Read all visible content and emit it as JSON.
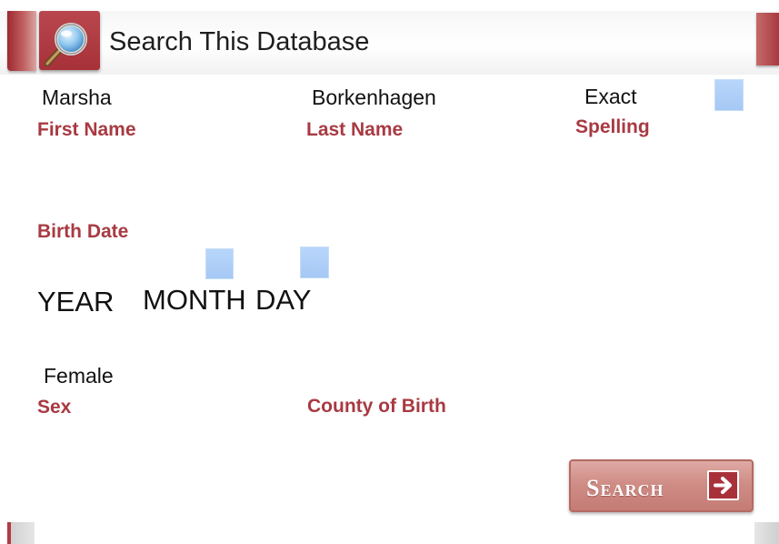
{
  "header": {
    "title": "Search This Database",
    "icon": "magnifier-icon",
    "accent_color": "#a83a42"
  },
  "fields": {
    "first_name": {
      "value": "Marsha",
      "label": "First Name"
    },
    "last_name": {
      "value": "Borkenhagen",
      "label": "Last Name"
    },
    "exact_spelling": {
      "value": "Exact",
      "label": "Spelling",
      "checked": false
    },
    "birth_date": {
      "label": "Birth Date",
      "year": "YEAR",
      "month": "MONTH",
      "day": "DAY"
    },
    "sex": {
      "value": "Female",
      "label": "Sex"
    },
    "county_of_birth": {
      "value": "",
      "label": "County of Birth"
    }
  },
  "search_button": {
    "label": "Search",
    "icon": "arrow-right-icon"
  },
  "colors": {
    "label": "#a83a42",
    "checkbox": "#a6c8f5",
    "button": "#cf8d86"
  }
}
